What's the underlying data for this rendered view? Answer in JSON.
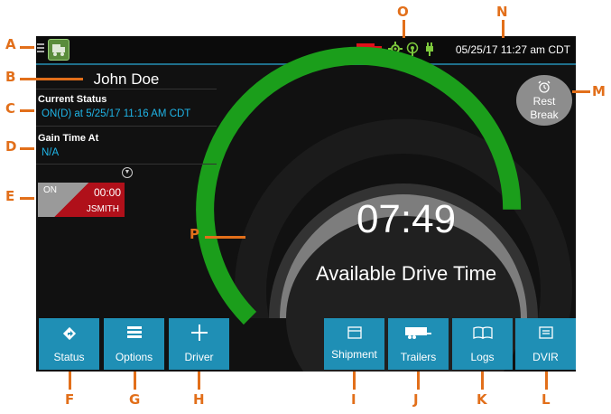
{
  "status_bar": {
    "datetime": "05/25/17 11:27 am CDT",
    "icons": [
      "menu-icon",
      "app-logo",
      "truck-icon",
      "gps-icon",
      "signal-icon",
      "plug-icon"
    ],
    "truck_color": "#e0101a",
    "indicator_color": "#7cc83c"
  },
  "driver": {
    "name": "John Doe"
  },
  "current_status": {
    "title": "Current Status",
    "value": "ON(D) at 5/25/17 11:16 AM CDT"
  },
  "gain_time": {
    "title": "Gain Time At",
    "value": "N/A"
  },
  "duty_card": {
    "status": "ON",
    "time": "00:00",
    "user": "JSMITH"
  },
  "gauge": {
    "time": "07:49",
    "label": "Available Drive Time",
    "ring_color": "#1b9e1b",
    "fraction": 0.75
  },
  "rest_break": {
    "line1": "Rest",
    "line2": "Break"
  },
  "nav": [
    {
      "label": "Status",
      "icon": "directions-icon"
    },
    {
      "label": "Options",
      "icon": "list-icon"
    },
    {
      "label": "Driver",
      "icon": "plus-icon"
    },
    {
      "label": "Shipment",
      "icon": "box-icon"
    },
    {
      "label": "Trailers",
      "icon": "trailer-icon"
    },
    {
      "label": "Logs",
      "icon": "book-icon"
    },
    {
      "label": "DVIR",
      "icon": "report-icon"
    }
  ],
  "callouts": [
    "A",
    "B",
    "C",
    "D",
    "E",
    "F",
    "G",
    "H",
    "I",
    "J",
    "K",
    "L",
    "M",
    "N",
    "O",
    "P"
  ],
  "accent": "#1f8fb5",
  "callout_color": "#e26f1a"
}
